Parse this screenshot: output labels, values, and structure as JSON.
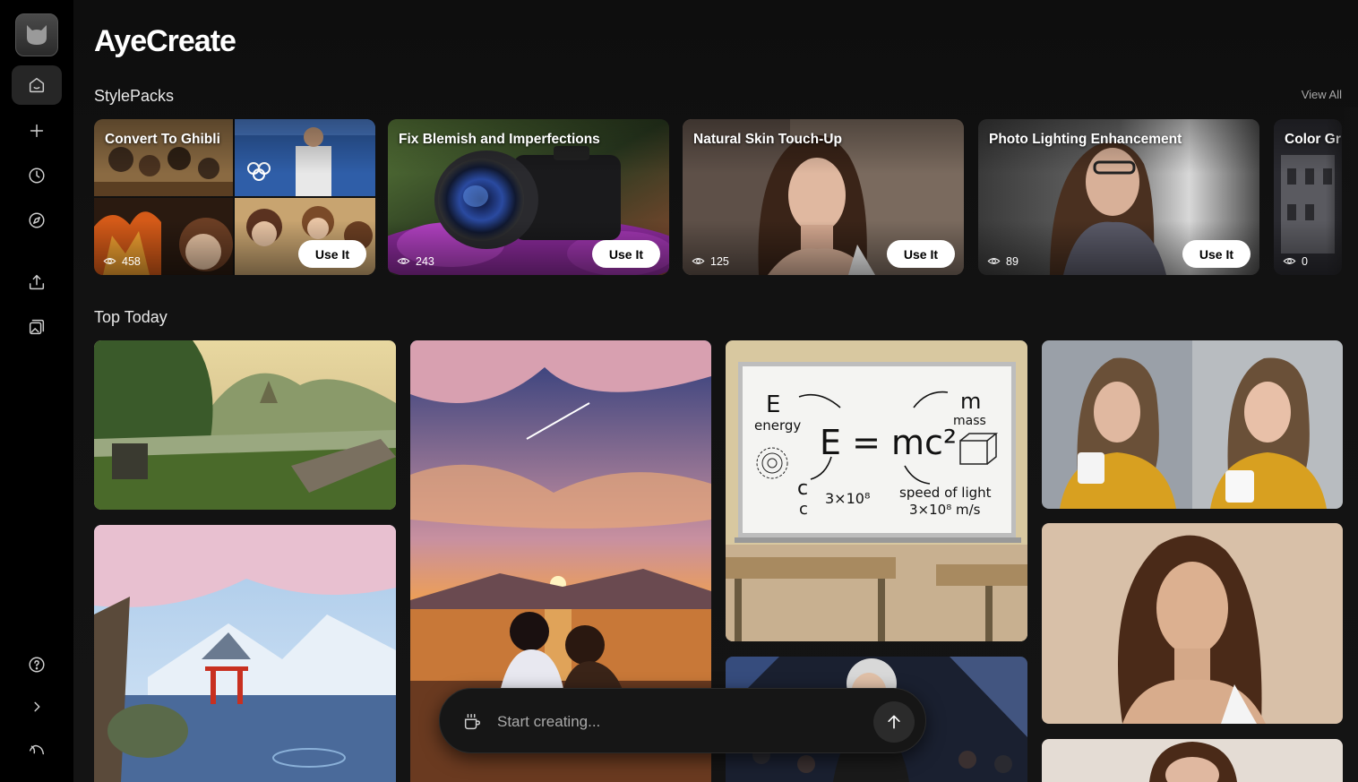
{
  "app": {
    "title": "AyeCreate"
  },
  "sidebar": {
    "items": [
      {
        "icon": "home-icon",
        "active": true
      },
      {
        "icon": "plus-icon"
      },
      {
        "icon": "clock-icon"
      },
      {
        "icon": "compass-icon"
      },
      {
        "icon": "upload-icon"
      },
      {
        "icon": "gallery-edit-icon"
      },
      {
        "icon": "help-icon"
      },
      {
        "icon": "chevron-right-icon"
      },
      {
        "icon": "brand-swirl-icon"
      }
    ]
  },
  "stylepacks": {
    "title": "StylePacks",
    "view_all": "View All",
    "use_label": "Use It",
    "items": [
      {
        "title": "Convert To Ghibli",
        "views": "458"
      },
      {
        "title": "Fix Blemish and Imperfections",
        "views": "243"
      },
      {
        "title": "Natural Skin Touch-Up",
        "views": "125"
      },
      {
        "title": "Photo Lighting Enhancement",
        "views": "89"
      },
      {
        "title": "Color Gr",
        "views": "0"
      }
    ]
  },
  "top_today": {
    "title": "Top Today",
    "whiteboard": {
      "e": "E",
      "energy": "energy",
      "formula": "E = mc²",
      "m": "m",
      "mass": "mass",
      "c": "c",
      "c2": "c",
      "c_value": "3×10⁸",
      "speed": "speed of light",
      "speed_value": "3×10⁸ m/s"
    }
  },
  "composer": {
    "placeholder": "Start creating..."
  },
  "colors": {
    "background": "#0a0a0a",
    "sidebar": "#000000",
    "button_bg": "#ffffff",
    "accent_active": "#262626"
  }
}
